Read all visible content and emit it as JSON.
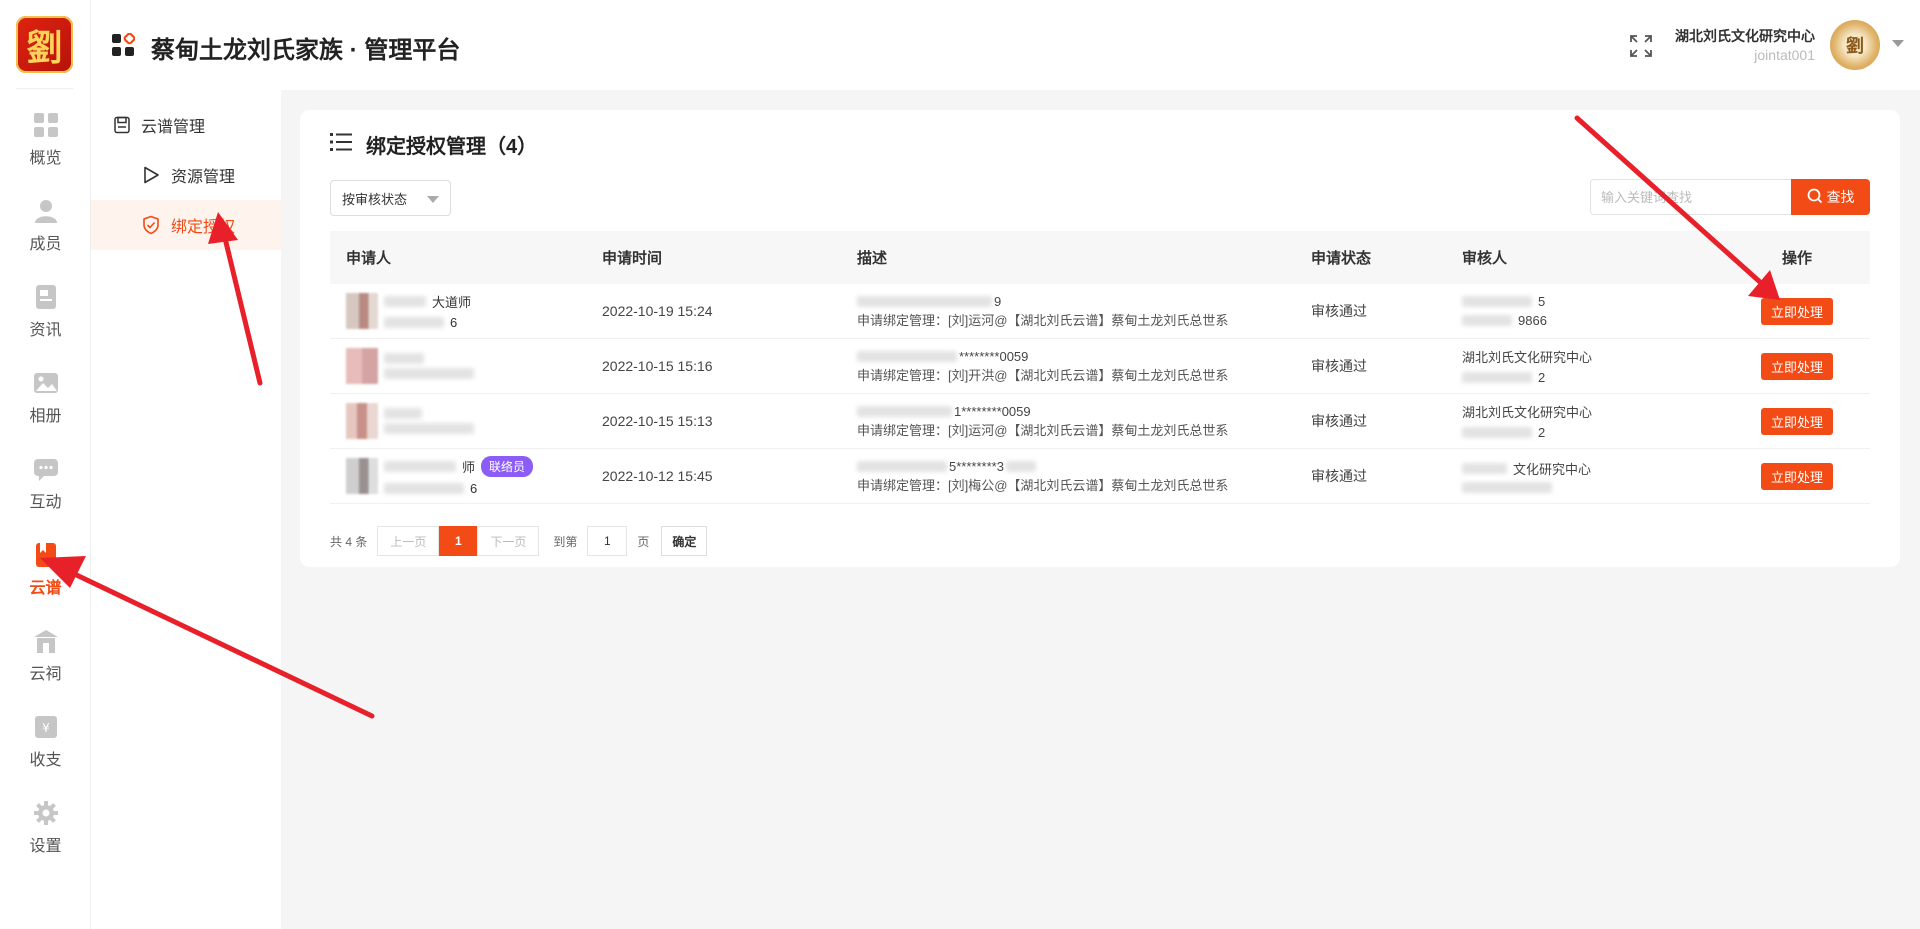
{
  "logo_char": "劉",
  "rail": [
    {
      "label": "概览",
      "icon": "grid-icon"
    },
    {
      "label": "成员",
      "icon": "person-icon"
    },
    {
      "label": "资讯",
      "icon": "news-icon"
    },
    {
      "label": "相册",
      "icon": "photo-icon"
    },
    {
      "label": "互动",
      "icon": "chat-icon"
    },
    {
      "label": "云谱",
      "icon": "book-icon",
      "active": true
    },
    {
      "label": "云祠",
      "icon": "temple-icon"
    },
    {
      "label": "收支",
      "icon": "money-icon"
    },
    {
      "label": "设置",
      "icon": "gear-icon"
    }
  ],
  "header": {
    "title": "蔡甸土龙刘氏家族 · 管理平台",
    "org_name": "湖北刘氏文化研究中心",
    "user_id": "jointat001",
    "avatar_char": "劉"
  },
  "subnav": {
    "group_label": "云谱管理",
    "items": [
      {
        "label": "资源管理"
      },
      {
        "label": "绑定授权",
        "active": true
      }
    ]
  },
  "card": {
    "title": "绑定授权管理（4）",
    "filter_label": "按审核状态",
    "search_placeholder": "输入关键词查找",
    "search_button": "查找"
  },
  "table": {
    "headers": [
      "申请人",
      "申请时间",
      "描述",
      "申请状态",
      "审核人",
      "操作"
    ],
    "rows": [
      {
        "name_tail": "大道师",
        "id_tail": "6",
        "badge": "",
        "time": "2022-10-19 15:24",
        "desc_top": "9",
        "desc": "申请绑定管理：[刘]运河@【湖北刘氏云谱】蔡甸土龙刘氏总世系",
        "status": "审核通过",
        "reviewer_top": "5",
        "reviewer_bottom": "9866",
        "action": "立即处理"
      },
      {
        "name_tail": "",
        "id_tail": "",
        "badge": "",
        "time": "2022-10-15 15:16",
        "desc_top": "********0059",
        "desc": "申请绑定管理：[刘]开洪@【湖北刘氏云谱】蔡甸土龙刘氏总世系",
        "status": "审核通过",
        "reviewer_top": "湖北刘氏文化研究中心",
        "reviewer_bottom": "2",
        "action": "立即处理"
      },
      {
        "name_tail": "",
        "id_tail": "",
        "badge": "",
        "time": "2022-10-15 15:13",
        "desc_top": "1********0059",
        "desc": "申请绑定管理：[刘]运河@【湖北刘氏云谱】蔡甸土龙刘氏总世系",
        "status": "审核通过",
        "reviewer_top": "湖北刘氏文化研究中心",
        "reviewer_bottom": "2",
        "action": "立即处理"
      },
      {
        "name_tail": "师",
        "id_tail": "6",
        "badge": "联络员",
        "time": "2022-10-12 15:45",
        "desc_top": "5********3",
        "desc": "申请绑定管理：[刘]梅公@【湖北刘氏云谱】蔡甸土龙刘氏总世系",
        "status": "审核通过",
        "reviewer_top": "文化研究中心",
        "reviewer_bottom": "",
        "action": "立即处理"
      }
    ]
  },
  "pager": {
    "total": "共 4 条",
    "prev": "上一页",
    "current": "1",
    "next": "下一页",
    "goto": "到第",
    "page_value": "1",
    "page_unit": "页",
    "confirm": "确定"
  },
  "colors": {
    "accent": "#f24b15",
    "badge": "#8b5cf6",
    "arrow": "#e8202a"
  }
}
